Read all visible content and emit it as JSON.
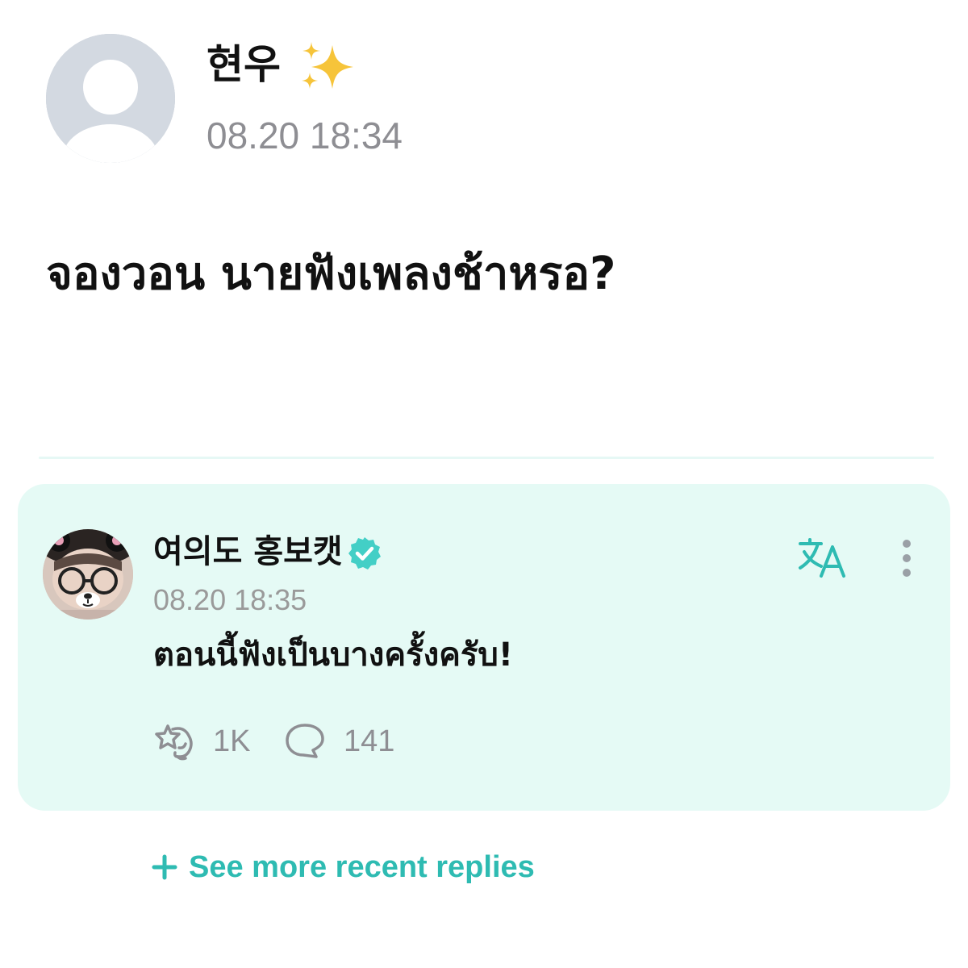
{
  "post": {
    "author_name": "현우",
    "author_emoji_icon": "sparkles-icon",
    "timestamp": "08.20 18:34",
    "body": "จองวอน นายฟังเพลงช้าหรอ?"
  },
  "reply": {
    "author_name": "여의도 홍보캣",
    "verified_icon": "verified-badge-icon",
    "timestamp": "08.20 18:35",
    "body": "ตอนนี้ฟังเป็นบางครั้งครับ!",
    "likes_count": "1K",
    "comments_count": "141"
  },
  "see_more_label": "See more recent replies",
  "colors": {
    "accent": "#2ebbb2",
    "card_background": "#e5faf5",
    "muted_text": "#8e8e93",
    "avatar_placeholder": "#d3d9e1"
  }
}
